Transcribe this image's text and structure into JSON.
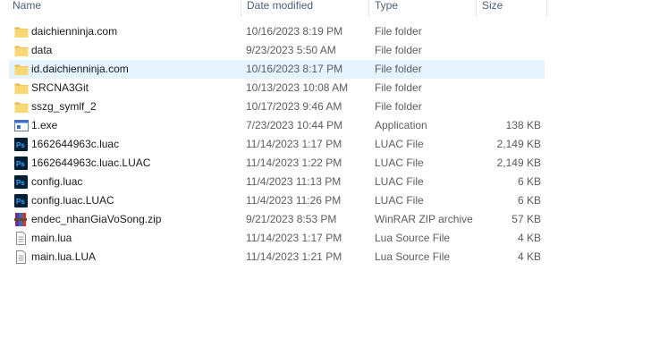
{
  "columns": {
    "name": "Name",
    "date": "Date modified",
    "type": "Type",
    "size": "Size"
  },
  "rows": [
    {
      "icon": "folder-icon",
      "name": "daichienninja.com",
      "date": "10/16/2023 8:19 PM",
      "type": "File folder",
      "size": "",
      "selected": false
    },
    {
      "icon": "folder-icon",
      "name": "data",
      "date": "9/23/2023 5:50 AM",
      "type": "File folder",
      "size": "",
      "selected": false
    },
    {
      "icon": "folder-icon",
      "name": "id.daichienninja.com",
      "date": "10/16/2023 8:17 PM",
      "type": "File folder",
      "size": "",
      "selected": true
    },
    {
      "icon": "folder-icon",
      "name": "SRCNA3Git",
      "date": "10/13/2023 10:08 AM",
      "type": "File folder",
      "size": "",
      "selected": false
    },
    {
      "icon": "folder-icon",
      "name": "sszg_symlf_2",
      "date": "10/17/2023 9:46 AM",
      "type": "File folder",
      "size": "",
      "selected": false
    },
    {
      "icon": "application-icon",
      "name": "1.exe",
      "date": "7/23/2023 10:44 PM",
      "type": "Application",
      "size": "138 KB",
      "selected": false
    },
    {
      "icon": "photoshop-file-icon",
      "name": "1662644963c.luac",
      "date": "11/14/2023 1:17 PM",
      "type": "LUAC File",
      "size": "2,149 KB",
      "selected": false
    },
    {
      "icon": "photoshop-file-icon",
      "name": "1662644963c.luac.LUAC",
      "date": "11/14/2023 1:22 PM",
      "type": "LUAC File",
      "size": "2,149 KB",
      "selected": false
    },
    {
      "icon": "photoshop-file-icon",
      "name": "config.luac",
      "date": "11/4/2023 11:13 PM",
      "type": "LUAC File",
      "size": "6 KB",
      "selected": false
    },
    {
      "icon": "photoshop-file-icon",
      "name": "config.luac.LUAC",
      "date": "11/4/2023 11:26 PM",
      "type": "LUAC File",
      "size": "6 KB",
      "selected": false
    },
    {
      "icon": "winrar-archive-icon",
      "name": "endec_nhanGiaVoSong.zip",
      "date": "9/21/2023 8:53 PM",
      "type": "WinRAR ZIP archive",
      "size": "57 KB",
      "selected": false
    },
    {
      "icon": "text-document-icon",
      "name": "main.lua",
      "date": "11/14/2023 1:17 PM",
      "type": "Lua Source File",
      "size": "4 KB",
      "selected": false
    },
    {
      "icon": "text-document-icon",
      "name": "main.lua.LUA",
      "date": "11/14/2023 1:21 PM",
      "type": "Lua Source File",
      "size": "4 KB",
      "selected": false
    }
  ],
  "colors": {
    "header_text": "#4c607a",
    "selection": "#e5f3ff",
    "folder": "#f8d775",
    "photoshop": "#001e36",
    "photoshop_accent": "#31a8ff"
  }
}
